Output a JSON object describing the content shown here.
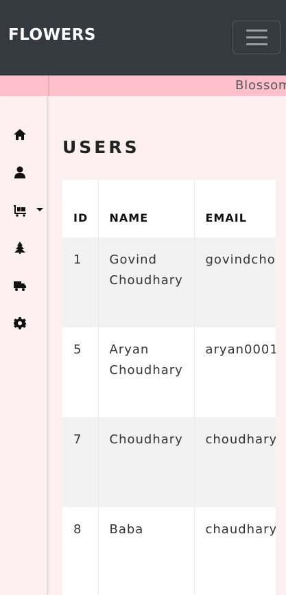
{
  "navbar": {
    "brand": "FLOWERS",
    "menu_icon": "hamburger-icon"
  },
  "ticker": {
    "text": "Blossom"
  },
  "sidebar": {
    "items": [
      {
        "icon": "home-icon"
      },
      {
        "icon": "user-icon"
      },
      {
        "icon": "cart-icon",
        "has_dropdown": true
      },
      {
        "icon": "tree-icon"
      },
      {
        "icon": "truck-icon"
      },
      {
        "icon": "gear-icon"
      }
    ]
  },
  "main": {
    "title": "USERS",
    "table": {
      "headers": [
        "ID",
        "NAME",
        "EMAIL"
      ],
      "rows": [
        {
          "id": "1",
          "name": "Govind Choudhary",
          "email": "govindcho"
        },
        {
          "id": "5",
          "name": "Aryan Choudhary",
          "email": "aryan0001"
        },
        {
          "id": "7",
          "name": "Choudhary",
          "email": "choudhary"
        },
        {
          "id": "8",
          "name": "Baba",
          "email": "chaudhary"
        }
      ]
    }
  }
}
